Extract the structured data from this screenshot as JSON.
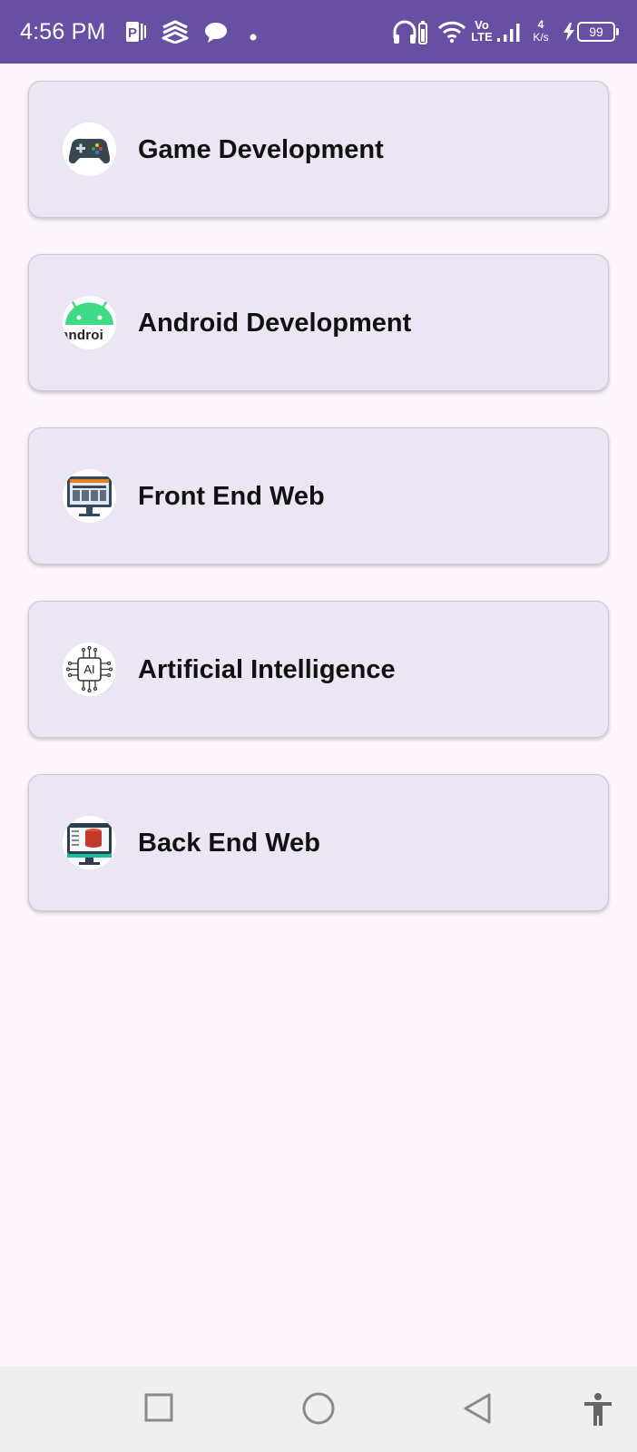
{
  "status_bar": {
    "time": "4:56 PM",
    "network_top": "Vo",
    "network_bottom": "LTE",
    "speed_value": "4",
    "speed_unit": "K/s",
    "battery": "99",
    "icons": [
      "p-badge-icon",
      "layers-icon",
      "chat-bubble-icon",
      "dot-icon",
      "headphones-battery-icon",
      "wifi-icon",
      "signal-icon",
      "charging-icon",
      "battery-icon"
    ]
  },
  "categories": [
    {
      "label": "Game Development",
      "icon": "gamepad-icon"
    },
    {
      "label": "Android Development",
      "icon": "android-icon",
      "icon_text": "androi"
    },
    {
      "label": "Front End Web",
      "icon": "web-monitor-icon"
    },
    {
      "label": "Artificial Intelligence",
      "icon": "ai-chip-icon",
      "icon_text": "AI"
    },
    {
      "label": "Back End Web",
      "icon": "database-monitor-icon"
    }
  ],
  "nav_bar": {
    "buttons": [
      "recents-square-button",
      "home-circle-button",
      "back-triangle-button",
      "accessibility-button"
    ]
  },
  "colors": {
    "status_bar": "#6750a4",
    "background": "#fcf6fc",
    "card": "#ece5f3",
    "nav_bar": "#efefef"
  }
}
